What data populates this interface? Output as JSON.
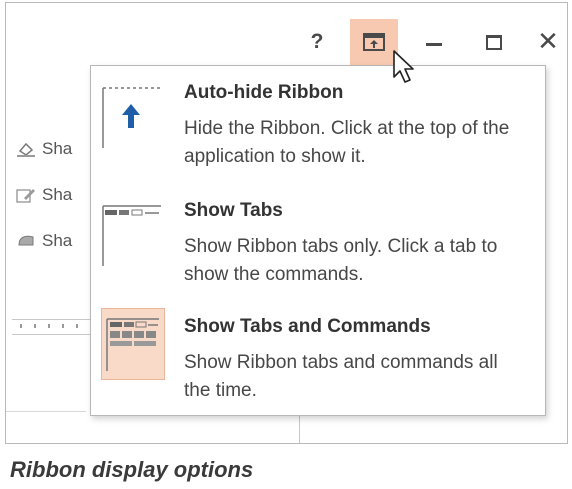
{
  "window_controls": {
    "help_label": "?",
    "ribbon_options_icon": "ribbon-display-options-icon",
    "minimize_icon": "minimize-icon",
    "maximize_icon": "maximize-icon",
    "close_label": "✕",
    "active_highlight_color": "#f8c9b1"
  },
  "background": {
    "side_items": [
      {
        "icon": "shape-fill-icon",
        "label": "Sha"
      },
      {
        "icon": "shape-outline-icon",
        "label": "Sha"
      },
      {
        "icon": "shape-effects-icon",
        "label": "Sha"
      }
    ]
  },
  "menu": {
    "items": [
      {
        "icon": "auto-hide-ribbon-icon",
        "title": "Auto-hide Ribbon",
        "description": "Hide the Ribbon. Click at the top of the application to show it.",
        "selected": false
      },
      {
        "icon": "show-tabs-icon",
        "title": "Show Tabs",
        "description": "Show Ribbon tabs only. Click a tab to show the commands.",
        "selected": false
      },
      {
        "icon": "show-tabs-and-commands-icon",
        "title": "Show Tabs and Commands",
        "description": "Show Ribbon tabs and commands all the time.",
        "selected": true
      }
    ]
  },
  "caption": "Ribbon display options",
  "colors": {
    "highlight": "#f9d9c8",
    "highlight_border": "#e9b69c",
    "accent_blue": "#1f5fa8"
  }
}
